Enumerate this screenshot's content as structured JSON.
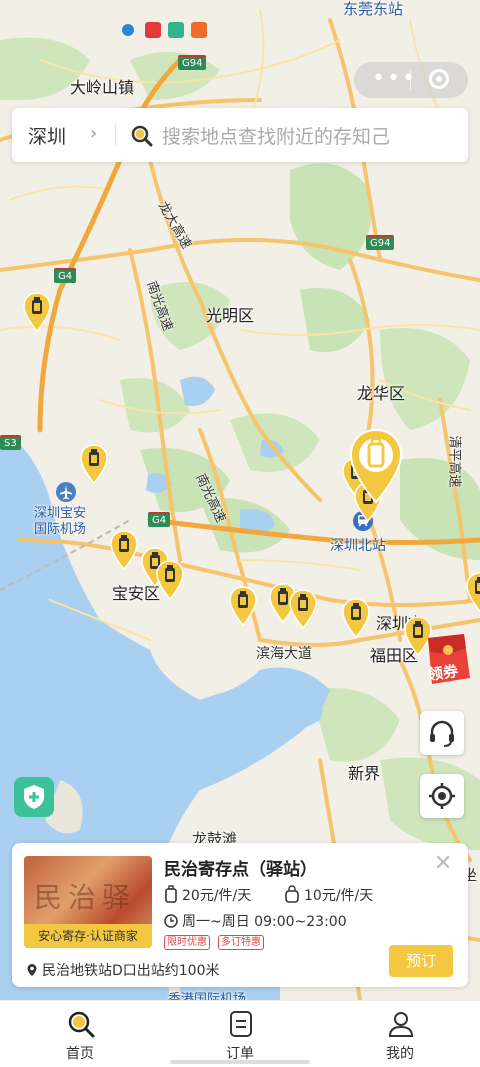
{
  "map": {
    "labels": {
      "dongguan_east": "东莞东站",
      "daling": "大岭山镇",
      "guangming": "光明区",
      "longhua": "龙华区",
      "airport": "深圳宝安\n国际机场",
      "baoan": "宝安区",
      "shenzhen_north": "深圳北站",
      "shenzhen_city": "深圳市",
      "futian": "福田区",
      "binhai": "滨海大道",
      "xinjie": "新界",
      "longgutan": "龙鼓滩",
      "hk_airport": "香港国际机场",
      "longda": "龙大高速",
      "nanguang1": "南光高速",
      "nanguang2": "南光高速",
      "qingping": "清平高速",
      "right_edge": "坐"
    },
    "road_tags": {
      "g94_top": "G94",
      "g94_mid": "G94",
      "g4_left": "G4",
      "g4_mid": "G4",
      "s3": "S3"
    }
  },
  "search": {
    "city": "深圳",
    "placeholder": "搜索地点查找附近的存知己"
  },
  "coupon": {
    "label": "领券"
  },
  "store_card": {
    "name": "民治寄存点（驿站）",
    "price_large": "20元/件/天",
    "price_small": "10元/件/天",
    "hours": "周一~周日 09:00~23:00",
    "tags": [
      "限时优惠",
      "多订特惠"
    ],
    "badge": "安心寄存·认证商家",
    "address": "民治地铁站D口出站约100米",
    "book_label": "预订"
  },
  "tabs": [
    {
      "label": "首页"
    },
    {
      "label": "订单"
    },
    {
      "label": "我的"
    }
  ],
  "colors": {
    "accent": "#f3c740",
    "tag_red": "#e04a4a",
    "shield_green": "#3cc29a"
  }
}
